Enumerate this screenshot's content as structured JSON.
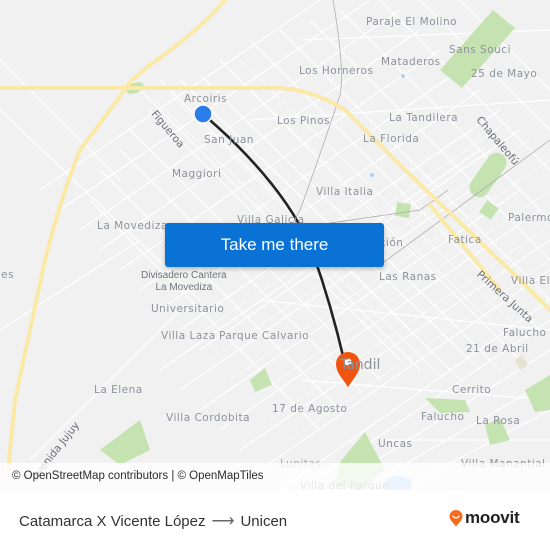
{
  "map": {
    "places": [
      {
        "id": "paraje-el-molino",
        "label": "Paraje El Molino"
      },
      {
        "id": "sans-souci",
        "label": "Sans Souci"
      },
      {
        "id": "mataderos",
        "label": "Mataderos"
      },
      {
        "id": "los-horneros",
        "label": "Los Horneros"
      },
      {
        "id": "25-de-mayo",
        "label": "25 de Mayo"
      },
      {
        "id": "arcoiris",
        "label": "Arcoiris"
      },
      {
        "id": "los-pinos",
        "label": "Los Pinos"
      },
      {
        "id": "la-tandilera",
        "label": "La Tandilera"
      },
      {
        "id": "san-juan",
        "label": "San Juan"
      },
      {
        "id": "la-florida",
        "label": "La Florida"
      },
      {
        "id": "maggiori",
        "label": "Maggiori"
      },
      {
        "id": "villa-italia",
        "label": "Villa Italia"
      },
      {
        "id": "palermo",
        "label": "Palermo"
      },
      {
        "id": "la-movediza",
        "label": "La Movediza"
      },
      {
        "id": "villa-galicia",
        "label": "Villa Galicia"
      },
      {
        "id": "estacion",
        "label": "Estación"
      },
      {
        "id": "fatica",
        "label": "Fatica"
      },
      {
        "id": "nes",
        "label": "nes"
      },
      {
        "id": "las-ranas",
        "label": "Las Ranas"
      },
      {
        "id": "villa-el",
        "label": "Villa El"
      },
      {
        "id": "universitario",
        "label": "Universitario"
      },
      {
        "id": "falucho-i",
        "label": "Falucho I"
      },
      {
        "id": "villa-laza",
        "label": "Villa Laza"
      },
      {
        "id": "parque-calvario",
        "label": "Parque Calvario"
      },
      {
        "id": "21-de-abril",
        "label": "21 de Abril"
      },
      {
        "id": "la-elena",
        "label": "La Elena"
      },
      {
        "id": "cerrito",
        "label": "Cerrito"
      },
      {
        "id": "17-de-agosto",
        "label": "17 de Agosto"
      },
      {
        "id": "villa-cordobita",
        "label": "Villa Cordobita"
      },
      {
        "id": "falucho",
        "label": "Falucho"
      },
      {
        "id": "la-rosa",
        "label": "La Rosa"
      },
      {
        "id": "uncas",
        "label": "Uncas"
      },
      {
        "id": "villa-manantial",
        "label": "Villa Manantial"
      },
      {
        "id": "lunitas",
        "label": "Lunitas"
      },
      {
        "id": "villa-del-parque",
        "label": "Villa del Parque"
      }
    ],
    "poi": {
      "line1": "Divisadero Cantera",
      "line2": "La Movediza"
    },
    "streets": {
      "figueroa": "Figueroa",
      "chapaleofu": "Chapaleofú",
      "primera_junta": "Primera Junta",
      "avenida_jujuy": "Avenida Jujuy"
    },
    "city": "Tandil",
    "colors": {
      "background": "#f1f1f2",
      "major_road": "#fbe9a6",
      "park": "#c4e3b0",
      "route_line": "#222222",
      "origin_marker": "#2b7de9",
      "destination_marker": "#f0550f",
      "water": "#a9d3f5"
    }
  },
  "cta": {
    "label": "Take me there"
  },
  "attribution": "© OpenStreetMap contributors | © OpenMapTiles",
  "footer": {
    "origin": "Catamarca X Vicente López",
    "arrow": "⟶",
    "destination": "Unicen",
    "brand": "moovit",
    "brand_color": "#f56a1e"
  }
}
